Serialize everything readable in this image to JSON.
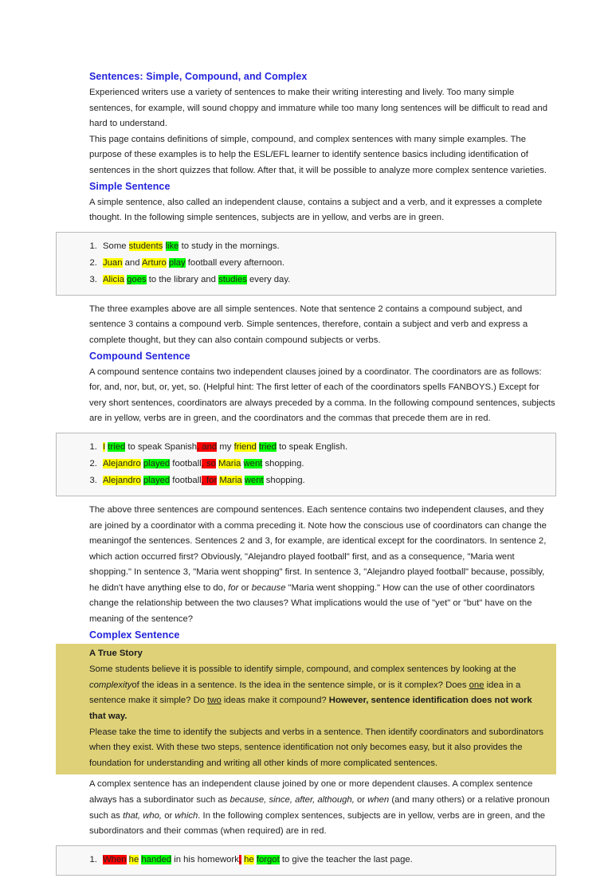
{
  "document": {
    "title": "Sentences: Simple, Compound, and Complex",
    "intro_paragraphs": [
      "Experienced writers use a variety of sentences to make their writing interesting and lively. Too many simple sentences, for example, will sound choppy and immature while too many long sentences will be difficult to read and hard to understand.",
      "This page contains definitions of simple, compound, and complex sentences with many simple examples. The purpose of these examples is to help the ESL/EFL learner to identify sentence basics including identification of sentences in the short quizzes that follow. After that, it will be possible to analyze more complex sentence varieties."
    ]
  },
  "simple_section": {
    "heading": "Simple Sentence",
    "intro": "A simple sentence, also called an independent clause, contains a subject and a verb, and it expresses a complete thought. In the following simple sentences, subjects are in yellow, and verbs are in green.",
    "examples": [
      {
        "number": "1.",
        "parts": [
          {
            "text": "Some ",
            "highlight": "none"
          },
          {
            "text": "students",
            "highlight": "yellow"
          },
          {
            "text": " ",
            "highlight": "none"
          },
          {
            "text": "like",
            "highlight": "green"
          },
          {
            "text": " to study in the mornings.",
            "highlight": "none"
          }
        ]
      },
      {
        "number": "2.",
        "parts": [
          {
            "text": "Juan",
            "highlight": "yellow"
          },
          {
            "text": " and ",
            "highlight": "none"
          },
          {
            "text": "Arturo",
            "highlight": "yellow"
          },
          {
            "text": " ",
            "highlight": "none"
          },
          {
            "text": "play",
            "highlight": "green"
          },
          {
            "text": " football every afternoon.",
            "highlight": "none"
          }
        ]
      },
      {
        "number": "3.",
        "parts": [
          {
            "text": "Alicia",
            "highlight": "yellow"
          },
          {
            "text": " ",
            "highlight": "none"
          },
          {
            "text": "goes",
            "highlight": "green"
          },
          {
            "text": " to the library and ",
            "highlight": "none"
          },
          {
            "text": "studies",
            "highlight": "green"
          },
          {
            "text": " every day.",
            "highlight": "none"
          }
        ]
      }
    ],
    "after": "The three examples above are all simple sentences. Note that sentence 2 contains a compound subject, and sentence 3 contains a compound verb. Simple sentences, therefore, contain a subject and verb and express a complete thought, but they can also contain compound subjects or verbs."
  },
  "compound_section": {
    "heading": "Compound Sentence",
    "intro": "A compound sentence contains two independent clauses joined by a coordinator. The coordinators are as follows: for, and, nor, but, or, yet, so. (Helpful hint: The first letter of each of the coordinators spells FANBOYS.) Except for very short sentences, coordinators are always preceded by a comma. In the following compound sentences, subjects are in yellow, verbs are in green, and the coordinators and the commas that precede them are in red.",
    "examples": [
      {
        "number": "1.",
        "parts": [
          {
            "text": "I",
            "highlight": "yellow"
          },
          {
            "text": " ",
            "highlight": "none"
          },
          {
            "text": "tried",
            "highlight": "green"
          },
          {
            "text": " to speak Spanish",
            "highlight": "none"
          },
          {
            "text": ", and",
            "highlight": "red"
          },
          {
            "text": " my ",
            "highlight": "none"
          },
          {
            "text": "friend",
            "highlight": "yellow"
          },
          {
            "text": " ",
            "highlight": "none"
          },
          {
            "text": "tried",
            "highlight": "green"
          },
          {
            "text": " to speak English.",
            "highlight": "none"
          }
        ]
      },
      {
        "number": "2.",
        "parts": [
          {
            "text": "Alejandro",
            "highlight": "yellow"
          },
          {
            "text": " ",
            "highlight": "none"
          },
          {
            "text": "played",
            "highlight": "green"
          },
          {
            "text": " football",
            "highlight": "none"
          },
          {
            "text": ", so",
            "highlight": "red"
          },
          {
            "text": " ",
            "highlight": "none"
          },
          {
            "text": "Maria",
            "highlight": "yellow"
          },
          {
            "text": " ",
            "highlight": "none"
          },
          {
            "text": "went",
            "highlight": "green"
          },
          {
            "text": " shopping.",
            "highlight": "none"
          }
        ]
      },
      {
        "number": "3.",
        "parts": [
          {
            "text": "Alejandro",
            "highlight": "yellow"
          },
          {
            "text": " ",
            "highlight": "none"
          },
          {
            "text": "played",
            "highlight": "green"
          },
          {
            "text": " football",
            "highlight": "none"
          },
          {
            "text": ", for",
            "highlight": "red"
          },
          {
            "text": " ",
            "highlight": "none"
          },
          {
            "text": "Maria",
            "highlight": "yellow"
          },
          {
            "text": " ",
            "highlight": "none"
          },
          {
            "text": "went",
            "highlight": "green"
          },
          {
            "text": " shopping.",
            "highlight": "none"
          }
        ]
      }
    ],
    "after_parts": [
      {
        "text": "The above three sentences are compound sentences. Each sentence contains two independent clauses, and they are joined by a coordinator with a comma preceding it. Note how the conscious use of coordinators can change the meaningof the sentences. Sentences 2 and 3, for example, are identical except for the coordinators. In sentence 2, which action occurred first? Obviously, \"Alejandro played football\" first, and as a consequence, \"Maria went shopping.\" In sentence 3, \"Maria went shopping\" first. In sentence 3, \"Alejandro played football\" because, possibly, he didn't have anything else to do, ",
        "style": "normal"
      },
      {
        "text": "for",
        "style": "italic"
      },
      {
        "text": " or ",
        "style": "normal"
      },
      {
        "text": "because",
        "style": "italic"
      },
      {
        "text": " \"Maria went shopping.\" How can the use of other coordinators change the relationship between the two clauses? What implications would the use of \"yet\" or \"but\" have on the meaning of the sentence?",
        "style": "normal"
      }
    ]
  },
  "complex_section": {
    "heading": "Complex Sentence",
    "story": {
      "title": "A True Story",
      "paragraph1_parts": [
        {
          "text": "Some students believe it is possible to identify simple, compound, and complex sentences by looking at the ",
          "style": "normal"
        },
        {
          "text": "complexity",
          "style": "italic"
        },
        {
          "text": "of the ideas in a sentence. Is the idea in the sentence simple, or is it complex? Does ",
          "style": "normal"
        },
        {
          "text": "one",
          "style": "underline"
        },
        {
          "text": " idea in a sentence make it simple? Do ",
          "style": "normal"
        },
        {
          "text": "two",
          "style": "underline"
        },
        {
          "text": " ideas make it compound? ",
          "style": "normal"
        },
        {
          "text": "However, sentence identification does not work that way.",
          "style": "bold"
        }
      ],
      "paragraph2": "Please take the time to identify the subjects and verbs in a sentence. Then identify coordinators and subordinators when they exist. With these two steps, sentence identification not only becomes easy, but it also provides the foundation for understanding and writing all other kinds of more complicated sentences."
    },
    "intro_parts": [
      {
        "text": "A complex sentence has an independent clause joined by one or more dependent clauses. A complex sentence always has a subordinator such as ",
        "style": "normal"
      },
      {
        "text": "because, since, after, although,",
        "style": "italic"
      },
      {
        "text": " or ",
        "style": "normal"
      },
      {
        "text": "when",
        "style": "italic"
      },
      {
        "text": " (and many others) or a relative pronoun such as ",
        "style": "normal"
      },
      {
        "text": "that, who,",
        "style": "italic"
      },
      {
        "text": " or ",
        "style": "normal"
      },
      {
        "text": "which",
        "style": "italic"
      },
      {
        "text": ". In the following complex sentences, subjects are in yellow, verbs are in green, and the subordinators and their commas (when required) are in red.",
        "style": "normal"
      }
    ],
    "examples": [
      {
        "number": "1.",
        "parts": [
          {
            "text": "When",
            "highlight": "red"
          },
          {
            "text": " ",
            "highlight": "none"
          },
          {
            "text": "he",
            "highlight": "yellow"
          },
          {
            "text": " ",
            "highlight": "none"
          },
          {
            "text": "handed",
            "highlight": "green"
          },
          {
            "text": " in his homework",
            "highlight": "none"
          },
          {
            "text": ",",
            "highlight": "red"
          },
          {
            "text": " ",
            "highlight": "none"
          },
          {
            "text": "he",
            "highlight": "yellow"
          },
          {
            "text": " ",
            "highlight": "none"
          },
          {
            "text": "forgot",
            "highlight": "green"
          },
          {
            "text": " to give the teacher the last page.",
            "highlight": "none"
          }
        ]
      }
    ]
  },
  "colors": {
    "heading_blue": "#2323dd",
    "highlight_yellow": "#ffff00",
    "highlight_green": "#00ff00",
    "highlight_red": "#ff0000",
    "story_background": "#ded177",
    "example_box_background": "#f8f8f8",
    "example_box_border": "#b9b9b9",
    "body_text": "#222222",
    "page_background": "#ffffff"
  }
}
